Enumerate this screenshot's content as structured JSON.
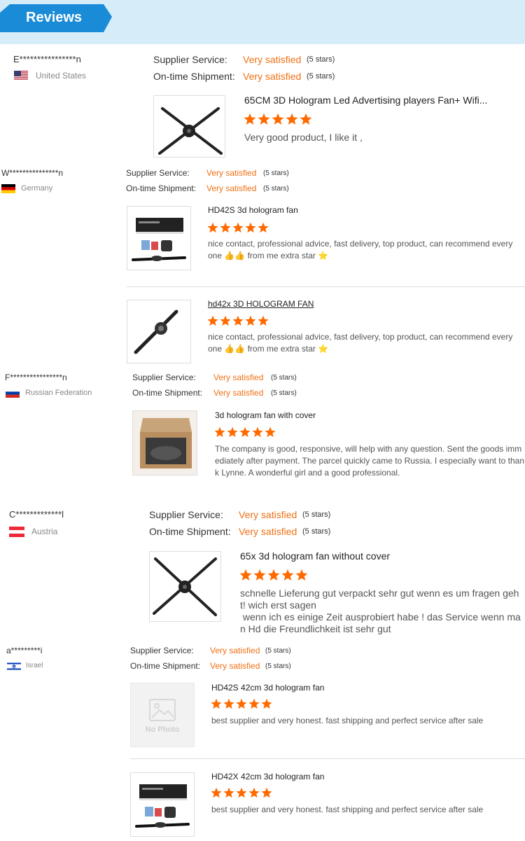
{
  "header": {
    "title": "Reviews"
  },
  "labels": {
    "supplier": "Supplier Service:",
    "shipment": "On-time Shipment:"
  },
  "rating_color": "#ff6a00",
  "reviews": [
    {
      "user": "E****************n",
      "country": "United States",
      "supplier_value": "Very satisfied",
      "supplier_stars": "(5 stars)",
      "shipment_value": "Very satisfied",
      "shipment_stars": "(5 stars)",
      "products": [
        {
          "title": "65CM 3D Hologram Led Advertising players Fan+ Wifi...",
          "rating": 5,
          "comment": "Very good product, I like it ,",
          "image": "hologram-fan-photo"
        }
      ]
    },
    {
      "user": "W***************n",
      "country": "Germany",
      "supplier_value": "Very satisfied",
      "supplier_stars": "(5 stars)",
      "shipment_value": "Very satisfied",
      "shipment_stars": "(5 stars)",
      "products": [
        {
          "title": "HD42S 3d hologram fan",
          "rating": 5,
          "comment": "nice contact, professional advice, fast delivery, top product, can recommend every one 👍👍 from me extra star ⭐",
          "image": "hologram-fan-box-photo"
        },
        {
          "title": "hd42x 3D HOLOGRAM FAN",
          "rating": 5,
          "comment": "nice contact, professional advice, fast delivery, top product, can recommend every one 👍👍 from me extra star ⭐",
          "image": "hologram-fan-blades-photo"
        }
      ]
    },
    {
      "user": "F****************n",
      "country": "Russian Federation",
      "supplier_value": "Very satisfied",
      "supplier_stars": "(5 stars)",
      "shipment_value": "Very satisfied",
      "shipment_stars": "(5 stars)",
      "products": [
        {
          "title": "3d hologram fan with cover",
          "rating": 5,
          "comment": "The company is good, responsive, will help with any question. Sent the goods immediately after payment. The parcel quickly came to Russia. I especially want to thank Lynne. A wonderful girl and a good professional.",
          "image": "hologram-fan-cardboard-box-photo"
        }
      ]
    },
    {
      "user": "C*************l",
      "country": "Austria",
      "supplier_value": "Very satisfied",
      "supplier_stars": "(5 stars)",
      "shipment_value": "Very satisfied",
      "shipment_stars": "(5 stars)",
      "products": [
        {
          "title": "65x 3d hologram fan without cover",
          "rating": 5,
          "comment": "schnelle Lieferung gut verpackt sehr gut wenn es um fragen geht! wich erst sagen\n wenn ich es einige Zeit ausprobiert habe ! das Service wenn man Hd die Freundlichkeit ist sehr gut",
          "image": "hologram-fan-photo"
        }
      ]
    },
    {
      "user": "a*********i",
      "country": "Israel",
      "supplier_value": "Very satisfied",
      "supplier_stars": "(5 stars)",
      "shipment_value": "Very satisfied",
      "shipment_stars": "(5 stars)",
      "products": [
        {
          "title": "HD42S 42cm 3d hologram fan",
          "rating": 5,
          "comment": "best supplier and very honest. fast shipping and perfect service after sale",
          "image": "no-photo-placeholder",
          "placeholder_text": "No Photo"
        },
        {
          "title": "HD42X 42cm 3d hologram fan",
          "rating": 5,
          "comment": "best supplier and very honest. fast shipping and perfect service after sale",
          "image": "hologram-fan-box-photo"
        }
      ]
    }
  ]
}
